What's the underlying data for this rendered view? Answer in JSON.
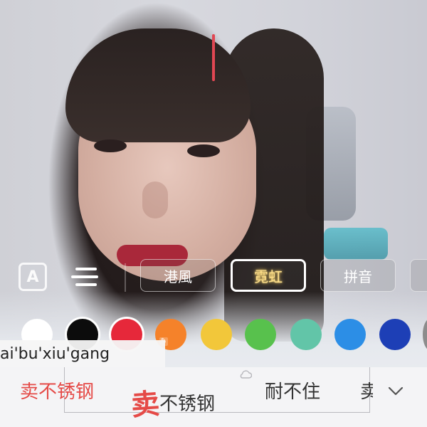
{
  "font_style_options": [
    {
      "label": "港風",
      "selected": false
    },
    {
      "label": "霓虹",
      "selected": true
    },
    {
      "label": "拼音",
      "selected": false
    }
  ],
  "text_toggle": {
    "label": "A"
  },
  "colors": {
    "swatches": [
      "#ffffff",
      "#0c0c0c",
      "#e6283a",
      "#f5822a",
      "#f2c73a",
      "#58c14d",
      "#62c5a8",
      "#2c8ee6",
      "#1d3fb6",
      "#8c8c8c"
    ],
    "selected_index": 2,
    "cursor_color": "#e14753",
    "accent_red": "#e54a47"
  },
  "ime": {
    "composing_text": "ai'bu'xiu'gang",
    "candidates": [
      {
        "text": "卖不锈钢",
        "highlighted": true
      },
      {
        "big_char": "卖",
        "rest": "不锈钢"
      },
      {
        "text": "耐不住"
      },
      {
        "text": "卖"
      }
    ]
  }
}
